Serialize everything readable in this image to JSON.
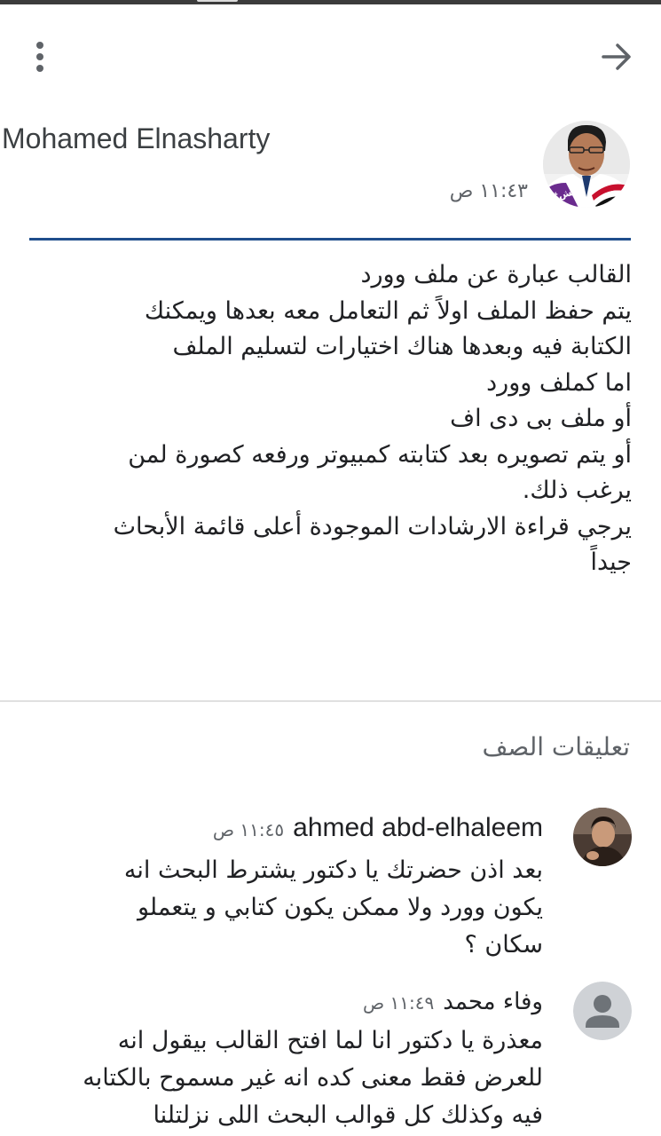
{
  "toolbar": {
    "more_icon": "more-vert-icon",
    "back_icon": "arrow-forward-icon"
  },
  "post": {
    "author": "Mohamed Elnasharty",
    "time": "١١:٤٣ ص",
    "avatar_badge": "#بلش",
    "lines": [
      "القالب عبارة عن ملف وورد",
      "يتم حفظ الملف اولاً ثم التعامل معه بعدها ويمكنك",
      "الكتابة فيه وبعدها هناك اختيارات لتسليم الملف",
      "اما كملف وورد",
      "أو ملف بى دى اف",
      "أو يتم تصويره بعد كتابته كمبيوتر ورفعه كصورة لمن",
      "يرغب ذلك.",
      "يرجي قراءة الارشادات الموجودة أعلى قائمة الأبحاث",
      "جيداً"
    ]
  },
  "comments_section": {
    "title": "تعليقات الصف",
    "comments": [
      {
        "author": "ahmed abd-elhaleem",
        "time": "١١:٤٥ ص",
        "lines": [
          "بعد اذن حضرتك يا دكتور يشترط البحث انه",
          "يكون وورد ولا ممكن يكون كتابي و يتعملو",
          "سكان ؟"
        ]
      },
      {
        "author": "وفاء محمد",
        "time": "١١:٤٩ ص",
        "lines": [
          "معذرة يا دكتور انا لما افتح القالب بيقول انه",
          "للعرض فقط معنى كده انه غير مسموح بالكتابه",
          "فيه وكذلك كل قوالب البحث اللى نزلتلنا"
        ]
      }
    ]
  },
  "colors": {
    "accent_divider": "#1f4e8c",
    "text": "#202124",
    "secondary_text": "#5f6368"
  }
}
